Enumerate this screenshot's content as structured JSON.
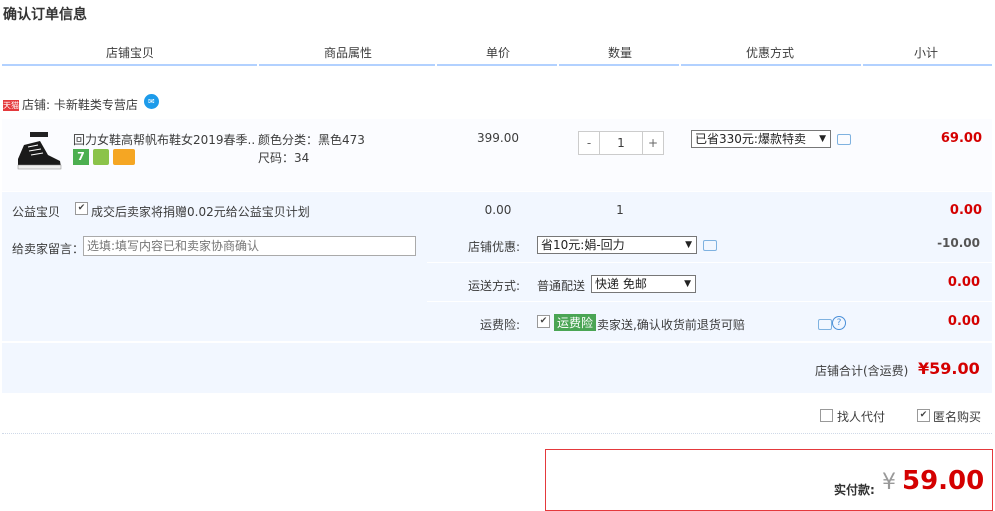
{
  "page": {
    "title": "确认订单信息"
  },
  "columns": [
    "店铺宝贝",
    "商品属性",
    "单价",
    "数量",
    "优惠方式",
    "小计"
  ],
  "shop": {
    "tmall_badge": "天猫",
    "label": "店铺: 卡新鞋类专营店",
    "ww_icon": "wangwang-icon"
  },
  "item": {
    "name": "回力女鞋高帮帆布鞋女2019春季...",
    "attr_color": "颜色分类：黑色473",
    "attr_size": "尺码：34",
    "price": "399.00",
    "qty_minus": "-",
    "qty": "1",
    "qty_plus": "+",
    "promo": "已省330元:爆款特卖",
    "subtotal": "69.00"
  },
  "charity": {
    "label": "公益宝贝",
    "text": "成交后卖家将捐赠0.02元给公益宝贝计划",
    "price": "0.00",
    "qty": "1",
    "subtotal": "0.00"
  },
  "message": {
    "label": "给卖家留言：",
    "placeholder": "选填:填写内容已和卖家协商确认"
  },
  "shop_discount": {
    "label": "店铺优惠:",
    "value": "省10元:娟-回力",
    "amount": "-10.00"
  },
  "shipping": {
    "label": "运送方式:",
    "type": "普通配送",
    "value": "快递 免邮",
    "amount": "0.00"
  },
  "insurance": {
    "label": "运费险:",
    "badge": "运费险",
    "text": "卖家送,确认收货前退货可赔",
    "amount": "0.00"
  },
  "shop_total": {
    "label": "店铺合计(含运费)",
    "value": "¥59.00"
  },
  "options": {
    "proxy_pay": "找人代付",
    "anonymous": "匿名购买"
  },
  "pay": {
    "label": "实付款:",
    "currency": "¥",
    "amount": "59.00"
  },
  "colors": {
    "accent_red": "#d40000",
    "bar_blue": "#b2d1ff",
    "row_bg": "#f2f7ff"
  }
}
